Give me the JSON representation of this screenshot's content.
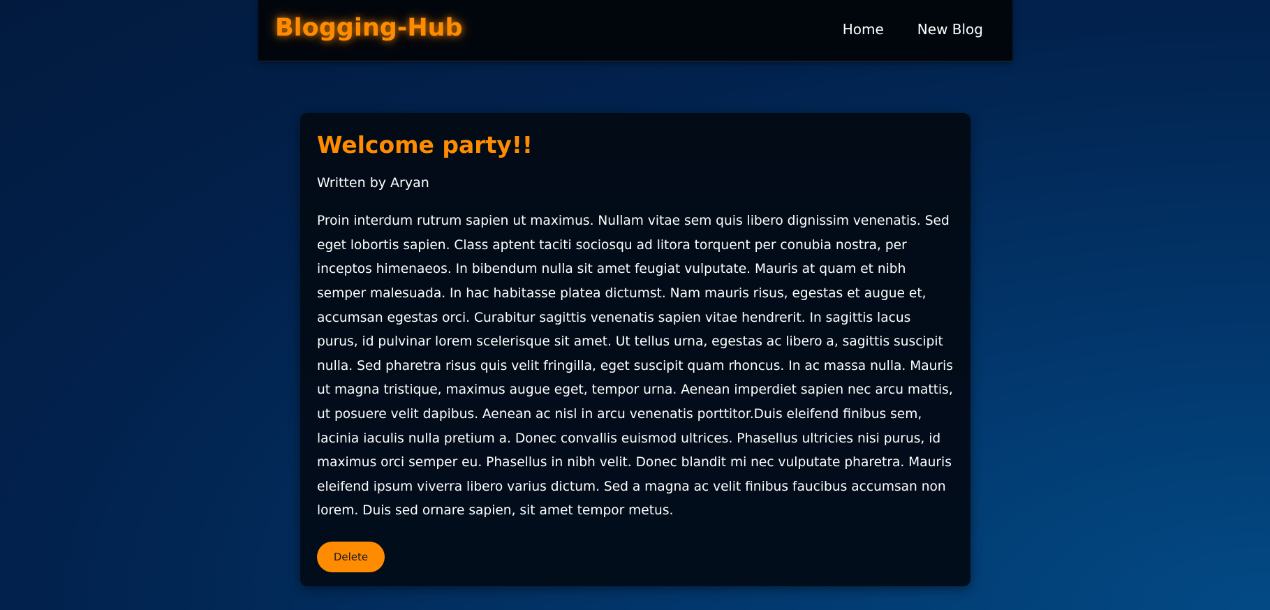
{
  "navbar": {
    "brand": "Blogging-Hub",
    "links": [
      {
        "label": "Home"
      },
      {
        "label": "New Blog"
      }
    ]
  },
  "post": {
    "title": "Welcome party!!",
    "author_line": "Written by Aryan",
    "body": "Proin interdum rutrum sapien ut maximus. Nullam vitae sem quis libero dignissim venenatis. Sed eget lobortis sapien. Class aptent taciti sociosqu ad litora torquent per conubia nostra, per inceptos himenaeos. In bibendum nulla sit amet feugiat vulputate. Mauris at quam et nibh semper malesuada. In hac habitasse platea dictumst. Nam mauris risus, egestas et augue et, accumsan egestas orci. Curabitur sagittis venenatis sapien vitae hendrerit. In sagittis lacus purus, id pulvinar lorem scelerisque sit amet. Ut tellus urna, egestas ac libero a, sagittis suscipit nulla. Sed pharetra risus quis velit fringilla, eget suscipit quam rhoncus. In ac massa nulla. Mauris ut magna tristique, maximus augue eget, tempor urna. Aenean imperdiet sapien nec arcu mattis, ut posuere velit dapibus. Aenean ac nisl in arcu venenatis porttitor.Duis eleifend finibus sem, lacinia iaculis nulla pretium a. Donec convallis euismod ultrices. Phasellus ultricies nisi purus, id maximus orci semper eu. Phasellus in nibh velit. Donec blandit mi nec vulputate pharetra. Mauris eleifend ipsum viverra libero varius dictum. Sed a magna ac velit finibus faucibus accumsan non lorem. Duis sed ornare sapien, sit amet tempor metus.",
    "delete_label": "Delete"
  },
  "colors": {
    "accent": "#ff8c00",
    "navbar_bg": "#01060d",
    "card_bg": "#020b16",
    "text": "#ffffff"
  }
}
